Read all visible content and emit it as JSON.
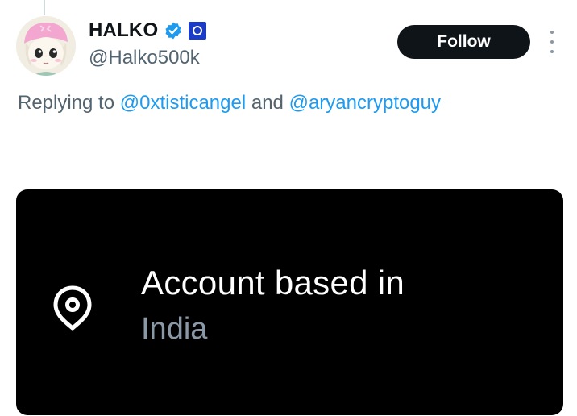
{
  "user": {
    "display_name": "HALKO",
    "handle": "@Halko500k",
    "verified": true,
    "verified_icon": "verified-badge-icon",
    "affiliate_icon": "affiliate-badge-icon"
  },
  "follow_button": {
    "label": "Follow"
  },
  "more_menu": {
    "icon": "more-vertical-icon"
  },
  "reply": {
    "prefix": "Replying to",
    "mention_1": "@0xtisticangel",
    "conjunction": "and",
    "mention_2": "@aryancryptoguy"
  },
  "account_info": {
    "icon": "location-pin-icon",
    "title": "Account based in",
    "value": "India"
  },
  "colors": {
    "accent_blue": "#1d9bf0",
    "text_primary": "#0f1419",
    "text_secondary": "#536471",
    "affiliate_blue": "#1a3cc8",
    "card_bg": "#000000"
  }
}
